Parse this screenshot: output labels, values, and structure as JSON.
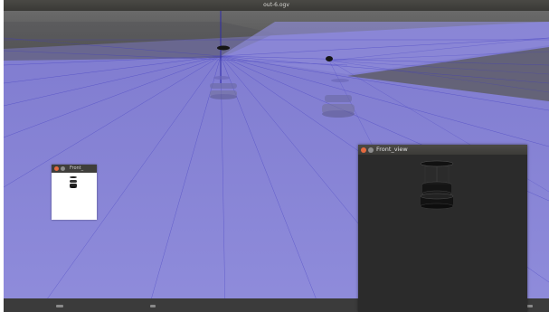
{
  "main_window": {
    "title": "out-6.ogv"
  },
  "scene": {
    "ground_color": "#8e8bd8",
    "sky_color": "#5c5c5c",
    "ray_color": "#3a35b8",
    "robot_count": 2
  },
  "windows": [
    {
      "title": "Front_",
      "close_button_color": "#e4693f",
      "minimize_button_color": "#8d8d8d",
      "content_background": "#ffffff"
    },
    {
      "title": "Front_view",
      "close_button_color": "#e4693f",
      "minimize_button_color": "#8d8d8d",
      "content_background": "#2b2b2b"
    }
  ],
  "colors": {
    "title_bar": "#3f3e3b",
    "title_text": "#d8d8d4",
    "bottom_bar": "#3b3b3b"
  }
}
